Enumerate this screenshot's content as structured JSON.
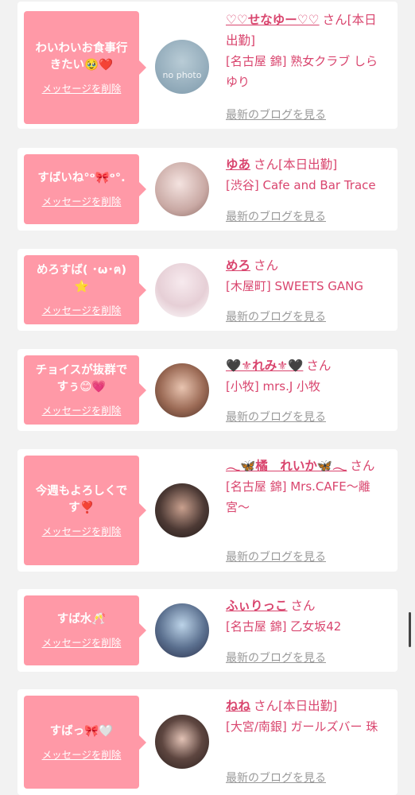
{
  "cards": [
    {
      "message": "わいわいお食事行きたい🥹❤️",
      "delete_label": "メッセージを削除",
      "name": "♡♡せなゆー♡♡",
      "honorific": "さん",
      "status": "[本日出勤]",
      "shop": "[名古屋 錦] 熟女クラブ しらゆり",
      "blog_label": "最新のブログを見る",
      "avatar_text": "no photo"
    },
    {
      "message": "すばいね°ᵒ🎀ᵒ°.",
      "delete_label": "メッセージを削除",
      "name": "ゆあ",
      "honorific": "さん",
      "status": "[本日出勤]",
      "shop": "[渋谷] Cafe and Bar Trace",
      "blog_label": "最新のブログを見る"
    },
    {
      "message": "めろすば( ･ω･ฅ)⭐",
      "delete_label": "メッセージを削除",
      "name": "めろ",
      "honorific": "さん",
      "status": "",
      "shop": "[木屋町] SWEETS GANG",
      "blog_label": "最新のブログを見る"
    },
    {
      "message": "チョイスが抜群ですぅ😊💗",
      "delete_label": "メッセージを削除",
      "name": "🖤⚜れみ⚜🖤",
      "honorific": "さん",
      "status": "",
      "shop": "[小牧] mrs.J 小牧",
      "blog_label": "最新のブログを見る"
    },
    {
      "message": "今週もよろしくです❣️",
      "delete_label": "メッセージを削除",
      "name": "𓂃🦋橘　れいか🦋𓂃",
      "honorific": "さん",
      "status": "",
      "shop": "[名古屋 錦] Mrs.CAFE〜離宮〜",
      "blog_label": "最新のブログを見る"
    },
    {
      "message": "すば水🥂",
      "delete_label": "メッセージを削除",
      "name": "ふぃりっこ",
      "honorific": "さん",
      "status": "",
      "shop": "[名古屋 錦] 乙女坂42",
      "blog_label": "最新のブログを見る"
    },
    {
      "message": "すばっ🎀🤍",
      "delete_label": "メッセージを削除",
      "name": "ねね",
      "honorific": "さん",
      "status": "[本日出勤]",
      "shop": "[大宮/南銀] ガールズバー 珠",
      "blog_label": "最新のブログを見る"
    }
  ],
  "colors": {
    "accent_pink": "#d9456e",
    "bubble_pink": "#ff99a7",
    "link_gray": "#999999",
    "background": "#f2f2f2"
  }
}
